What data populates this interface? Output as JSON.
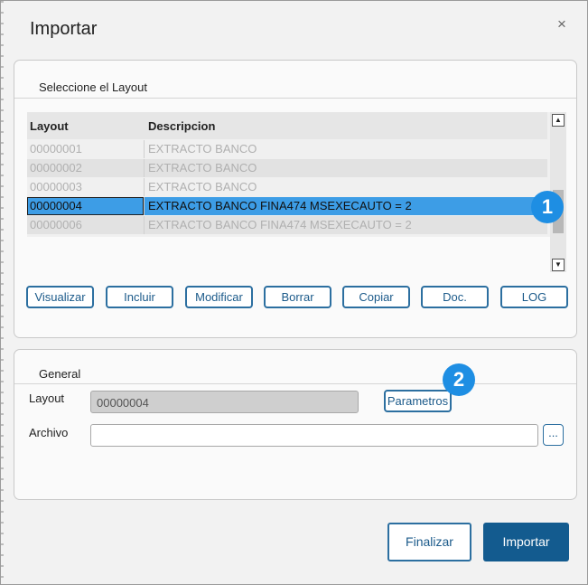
{
  "dialog": {
    "title": "Importar",
    "close_glyph": "×"
  },
  "layout_section": {
    "title": "Seleccione el Layout",
    "columns": [
      "Layout",
      "Descripcion"
    ],
    "rows": [
      {
        "layout": "00000001",
        "descripcion": "EXTRACTO BANCO"
      },
      {
        "layout": "00000002",
        "descripcion": "EXTRACTO BANCO"
      },
      {
        "layout": "00000003",
        "descripcion": "EXTRACTO BANCO"
      },
      {
        "layout": "00000004",
        "descripcion": "EXTRACTO BANCO FINA474 MSEXECAUTO = 2"
      },
      {
        "layout": "00000006",
        "descripcion": "EXTRACTO BANCO FINA474 MSEXECAUTO = 2"
      }
    ],
    "selected_row": 3,
    "buttons": [
      "Visualizar",
      "Incluir",
      "Modificar",
      "Borrar",
      "Copiar",
      "Doc.",
      "LOG"
    ],
    "scroll_up_glyph": "▲",
    "scroll_down_glyph": "▼"
  },
  "general_section": {
    "title": "General",
    "layout_label": "Layout",
    "layout_value": "00000004",
    "parametros_button": "Parametros",
    "archivo_label": "Archivo",
    "archivo_value": "",
    "browse_button": "..."
  },
  "footer": {
    "finalizar": "Finalizar",
    "importar": "Importar"
  },
  "badges": [
    "1",
    "2"
  ],
  "colors": {
    "selection": "#3d9de6",
    "accent": "#1b5a8a",
    "primary_button": "#135b8f",
    "badge": "#1e8ee3"
  }
}
